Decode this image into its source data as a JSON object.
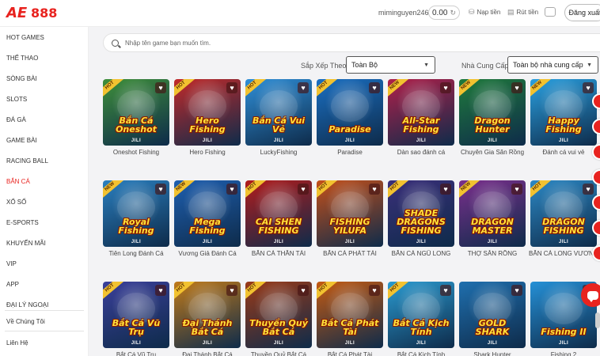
{
  "header": {
    "logo_letters": "AE",
    "logo_number": "888",
    "username": "miminguyen246",
    "balance": "0.00",
    "deposit_label": "Nạp tiền",
    "withdraw_label": "Rút tiền",
    "logout_label": "Đăng xuất"
  },
  "sidebar": {
    "items": [
      {
        "label": "HOT GAMES"
      },
      {
        "label": "THỂ THAO"
      },
      {
        "label": "SÒNG BÀI"
      },
      {
        "label": "SLOTS"
      },
      {
        "label": "ĐÁ GÀ"
      },
      {
        "label": "GAME BÀI"
      },
      {
        "label": "RACING BALL"
      },
      {
        "label": "BẮN CÁ"
      },
      {
        "label": "XỔ SỐ"
      },
      {
        "label": "E-SPORTS"
      },
      {
        "label": "KHUYẾN MÃI"
      },
      {
        "label": "VIP"
      },
      {
        "label": "APP"
      },
      {
        "label": "ĐẠI LÝ NGOẠI"
      },
      {
        "label": "Về Chúng Tôi"
      },
      {
        "label": "Liên Hệ"
      }
    ],
    "active": "BẮN CÁ"
  },
  "search": {
    "placeholder": "Nhập tên game bạn muốn tìm."
  },
  "filters": {
    "sort_label": "Sắp Xếp Theo",
    "sort_value": "Toàn Bộ",
    "provider_label": "Nhà Cung Cấp",
    "provider_value": "Toàn bộ nhà cung cấp"
  },
  "games": [
    {
      "name": "Oneshot Fishing",
      "art": "Bắn Cá Oneshot",
      "color": "#3e8f3a",
      "badge": "HOT"
    },
    {
      "name": "Hero Fishing",
      "art": "Hero Fishing",
      "color": "#c22a2a",
      "badge": "HOT"
    },
    {
      "name": "LuckyFishing",
      "art": "Bắn Cá Vui Vẻ",
      "color": "#2f8fd8",
      "badge": "HOT"
    },
    {
      "name": "Paradise",
      "art": "Paradise",
      "color": "#1a6fc2",
      "badge": "HOT"
    },
    {
      "name": "Dàn sao đánh cá",
      "art": "All-Star Fishing",
      "color": "#b0204a",
      "badge": "NEW"
    },
    {
      "name": "Chuyên Gia Săn Rồng",
      "art": "Dragon Hunter",
      "color": "#1f7a3c",
      "badge": "NEW"
    },
    {
      "name": "Đánh cá vui vẻ",
      "art": "Happy Fishing",
      "color": "#2aa0e0",
      "badge": "NEW"
    },
    {
      "name": "Tiên Long Đánh Cá",
      "art": "Royal Fishing",
      "color": "#2a7fbf",
      "badge": "NEW"
    },
    {
      "name": "Vương Giả Đánh Cá",
      "art": "Mega Fishing",
      "color": "#1e5fb0",
      "badge": "NEW"
    },
    {
      "name": "BẮN CÁ THẦN TÀI",
      "art": "CAI SHEN FISHING",
      "color": "#b31c1c",
      "badge": "HOT"
    },
    {
      "name": "BẮN CÁ PHÁT TÀI",
      "art": "FISHING YILUFA",
      "color": "#c4501a",
      "badge": "HOT"
    },
    {
      "name": "BẮN CÁ NGŨ LONG",
      "art": "SHADE DRAGONS FISHING",
      "color": "#3a2f7a",
      "badge": "HOT"
    },
    {
      "name": "THỢ SĂN RỒNG",
      "art": "DRAGON MASTER",
      "color": "#7a2f8c",
      "badge": "NEW"
    },
    {
      "name": "BẮN CÁ LONG VƯƠNG",
      "art": "DRAGON FISHING",
      "color": "#2c88c4",
      "badge": "HOT"
    },
    {
      "name": "Bắt Cá Vũ Trụ",
      "art": "Bắt Cá Vũ Trụ",
      "color": "#3a3f9a",
      "badge": "HOT"
    },
    {
      "name": "Đại Thánh Bắt Cá",
      "art": "Đại Thánh Bắt Cá",
      "color": "#c07a1a",
      "badge": "HOT"
    },
    {
      "name": "Thuyền Quỷ Bắt Cá",
      "art": "Thuyền Quỷ Bắt Cá",
      "color": "#9a3a18",
      "badge": "HOT"
    },
    {
      "name": "Bắt Cá Phát Tài",
      "art": "Bắt Cá Phát Tài",
      "color": "#c45a12",
      "badge": "HOT"
    },
    {
      "name": "Bắt Cá Kịch Tính",
      "art": "Bắt Cá Kịch Tính",
      "color": "#2a9ad0",
      "badge": "HOT"
    },
    {
      "name": "Shark Hunter",
      "art": "GOLD SHARK",
      "color": "#1f6fae",
      "badge": ""
    },
    {
      "name": "Fishing 2",
      "art": "Fishing II",
      "color": "#2590d6",
      "badge": ""
    }
  ],
  "card_tag": "JILI",
  "heart_icon": "heart-icon"
}
